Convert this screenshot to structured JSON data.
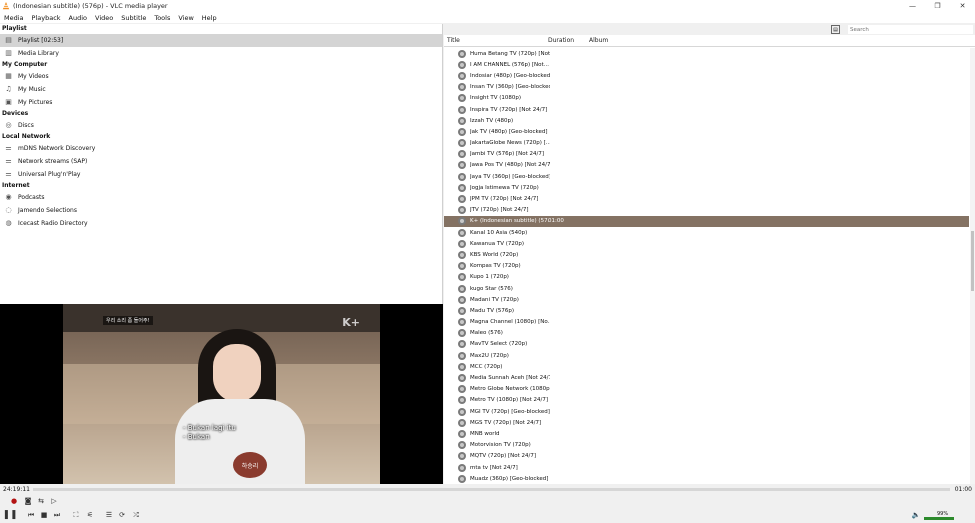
{
  "window": {
    "title": "(Indonesian subtitle) (576p) - VLC media player",
    "minimize": "—",
    "maximize": "❐",
    "close": "✕"
  },
  "menu": [
    "Media",
    "Playback",
    "Audio",
    "Video",
    "Subtitle",
    "Tools",
    "View",
    "Help"
  ],
  "sidebar": {
    "sections": [
      {
        "label": "Playlist",
        "items": [
          {
            "label": "Playlist [02:53]",
            "icon": "playlist-icon",
            "glyph": "▤",
            "selected": true
          },
          {
            "label": "Media Library",
            "icon": "library-icon",
            "glyph": "▥",
            "selected": false
          }
        ]
      },
      {
        "label": "My Computer",
        "items": [
          {
            "label": "My Videos",
            "icon": "video-folder-icon",
            "glyph": "▦"
          },
          {
            "label": "My Music",
            "icon": "music-note-icon",
            "glyph": "♫"
          },
          {
            "label": "My Pictures",
            "icon": "picture-icon",
            "glyph": "▣"
          }
        ]
      },
      {
        "label": "Devices",
        "items": [
          {
            "label": "Discs",
            "icon": "disc-icon",
            "glyph": "◎"
          }
        ]
      },
      {
        "label": "Local Network",
        "items": [
          {
            "label": "mDNS Network Discovery",
            "icon": "network-icon",
            "glyph": "⚌"
          },
          {
            "label": "Network streams (SAP)",
            "icon": "network-icon",
            "glyph": "⚌"
          },
          {
            "label": "Universal Plug'n'Play",
            "icon": "network-icon",
            "glyph": "⚌"
          }
        ]
      },
      {
        "label": "Internet",
        "items": [
          {
            "label": "Podcasts",
            "icon": "podcast-icon",
            "glyph": "◉"
          },
          {
            "label": "Jamendo Selections",
            "icon": "jamendo-icon",
            "glyph": "◌"
          },
          {
            "label": "Icecast Radio Directory",
            "icon": "radio-icon",
            "glyph": "◍"
          }
        ]
      }
    ]
  },
  "search": {
    "placeholder": "Search"
  },
  "playlist": {
    "columns": [
      "Title",
      "Duration",
      "Album"
    ],
    "rows": [
      {
        "title": "Huma Betang TV (720p) [Not..."
      },
      {
        "title": "I AM CHANNEL (576p) [Not..."
      },
      {
        "title": "Indosiar (480p) [Geo-blocked]"
      },
      {
        "title": "Insan TV (360p) [Geo-blocked]"
      },
      {
        "title": "Insight TV (1080p)"
      },
      {
        "title": "Inspira TV (720p) [Not 24/7]"
      },
      {
        "title": "Izzah TV (480p)"
      },
      {
        "title": "Jak TV (480p) [Geo-blocked]"
      },
      {
        "title": "JakartaGlobe News (720p) [..."
      },
      {
        "title": "Jambi TV (576p) [Not 24/7]"
      },
      {
        "title": "Jawa Pos TV (480p) [Not 24/7]"
      },
      {
        "title": "Jaya TV (360p) [Geo-blocked]"
      },
      {
        "title": "Jogja Istimewa TV (720p)"
      },
      {
        "title": "JPM TV (720p) [Not 24/7]"
      },
      {
        "title": "JTV (720p) [Not 24/7]"
      },
      {
        "title": "K+ (Indonesian subtitle) (57...",
        "duration": "01:00",
        "current": true
      },
      {
        "title": "Kanal 10 Asia (540p)"
      },
      {
        "title": "Kawanua TV (720p)"
      },
      {
        "title": "KBS World (720p)"
      },
      {
        "title": "Kompas TV (720p)"
      },
      {
        "title": "Kupo 1 (720p)"
      },
      {
        "title": "kugo Star (576)"
      },
      {
        "title": "Madani TV (720p)"
      },
      {
        "title": "Madu TV (576p)"
      },
      {
        "title": "Magna Channel (1080p) [No..."
      },
      {
        "title": "Maleo (576)"
      },
      {
        "title": "MavTV Select (720p)"
      },
      {
        "title": "Max2U (720p)"
      },
      {
        "title": "MCC (720p)"
      },
      {
        "title": "Media Sunnah Aceh [Not 24/7]"
      },
      {
        "title": "Metro Globe Network (1080p..."
      },
      {
        "title": "Metro TV (1080p) [Not 24/7]"
      },
      {
        "title": "MGI TV (720p) [Geo-blocked]"
      },
      {
        "title": "MGS TV (720p) [Not 24/7]"
      },
      {
        "title": "MNB world"
      },
      {
        "title": "Motorvision TV (720p)"
      },
      {
        "title": "MQTV (720p) [Not 24/7]"
      },
      {
        "title": "mta tv [Not 24/7]"
      },
      {
        "title": "Muadz (360p) [Geo-blocked]"
      }
    ]
  },
  "video": {
    "subtitle_top": "우리 소리 좀 들어주!",
    "channel_logo": "K+",
    "subtitle_main": "- Bukan lagi itu\n- Bukan",
    "name_tag": "하승리"
  },
  "player": {
    "elapsed": "24:19:11",
    "total": "01:00",
    "volume": "99%",
    "progress": 0
  }
}
